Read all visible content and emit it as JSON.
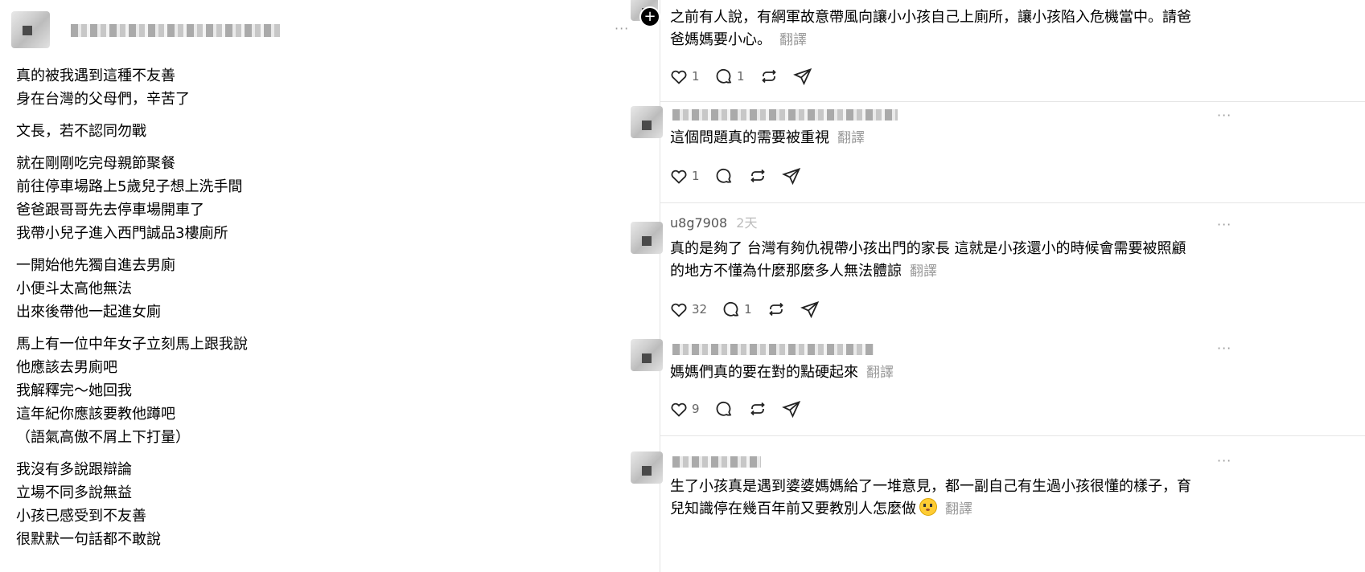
{
  "post": {
    "paragraphs": [
      [
        "真的被我遇到這種不友善",
        "身在台灣的父母們，辛苦了"
      ],
      [
        "文長，若不認同勿戰"
      ],
      [
        "就在剛剛吃完母親節聚餐",
        "前往停車場路上5歲兒子想上洗手間",
        "爸爸跟哥哥先去停車場開車了",
        "我帶小兒子進入西門誠品3樓廁所"
      ],
      [
        "一開始他先獨自進去男廁",
        "小便斗太高他無法",
        "出來後帶他一起進女廁"
      ],
      [
        "馬上有一位中年女子立刻馬上跟我說",
        "他應該去男廁吧",
        "我解釋完～她回我",
        "這年紀你應該要教他蹲吧",
        "（語氣高傲不屑上下打量）"
      ],
      [
        "我沒有多說跟辯論",
        "立場不同多說無益",
        "小孩已感受到不友善",
        "很默默一句話都不敢說"
      ]
    ]
  },
  "translate_label": "翻譯",
  "more_label": "···",
  "plus_label": "+",
  "comments": [
    {
      "lines": [
        "之前有人說，有網軍故意帶風向讓小小孩自己上廁所，讓小孩陷入危機當中。請爸",
        "爸媽媽要小心。"
      ],
      "likes": "1",
      "replies": "1"
    },
    {
      "lines": [
        "這個問題真的需要被重視"
      ],
      "likes": "1",
      "replies": ""
    },
    {
      "username": "u8g7908",
      "time": "2天",
      "lines": [
        "真的是夠了 台灣有夠仇視帶小孩出門的家長 這就是小孩還小的時候會需要被照顧",
        "的地方不懂為什麼那麼多人無法體諒"
      ],
      "likes": "32",
      "replies": "1"
    },
    {
      "lines": [
        "媽媽們真的要在對的點硬起來"
      ],
      "likes": "9",
      "replies": ""
    },
    {
      "lines": [
        "生了小孩真是遇到婆婆媽媽給了一堆意見，都一副自己有生過小孩很懂的樣子，育",
        "兒知識停在幾百年前又要教別人怎麼做"
      ],
      "likes": "",
      "replies": ""
    }
  ]
}
